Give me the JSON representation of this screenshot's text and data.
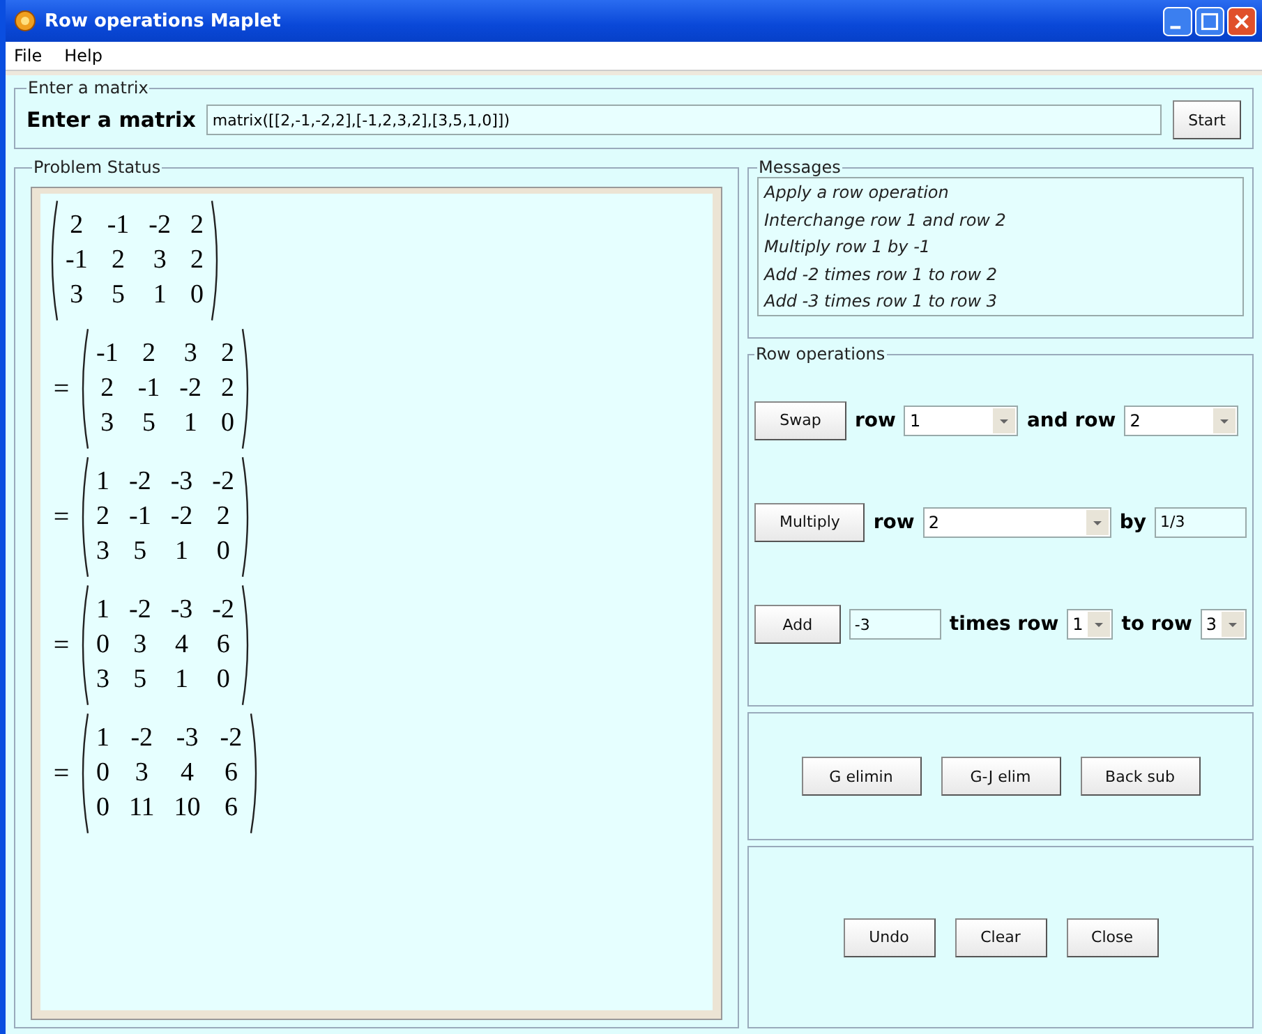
{
  "window": {
    "title": "Row operations Maplet"
  },
  "menu": [
    "File",
    "Help"
  ],
  "enter_matrix": {
    "group_title": "Enter a matrix",
    "label": "Enter a matrix",
    "value": "matrix([[2,-1,-2,2],[-1,2,3,2],[3,5,1,0]])",
    "button": "Start"
  },
  "problem_status": {
    "group_title": "Problem Status",
    "steps": [
      {
        "rows": [
          [
            "2",
            "-1",
            "-2",
            "2"
          ],
          [
            "-1",
            "2",
            "3",
            "2"
          ],
          [
            "3",
            "5",
            "1",
            "0"
          ]
        ]
      },
      {
        "relation": "=",
        "rows": [
          [
            "-1",
            "2",
            "3",
            "2"
          ],
          [
            "2",
            "-1",
            "-2",
            "2"
          ],
          [
            "3",
            "5",
            "1",
            "0"
          ]
        ]
      },
      {
        "relation": "=",
        "rows": [
          [
            "1",
            "-2",
            "-3",
            "-2"
          ],
          [
            "2",
            "-1",
            "-2",
            "2"
          ],
          [
            "3",
            "5",
            "1",
            "0"
          ]
        ]
      },
      {
        "relation": "=",
        "rows": [
          [
            "1",
            "-2",
            "-3",
            "-2"
          ],
          [
            "0",
            "3",
            "4",
            "6"
          ],
          [
            "3",
            "5",
            "1",
            "0"
          ]
        ]
      },
      {
        "relation": "=",
        "rows": [
          [
            "1",
            "-2",
            "-3",
            "-2"
          ],
          [
            "0",
            "3",
            "4",
            "6"
          ],
          [
            "0",
            "11",
            "10",
            "6"
          ]
        ]
      }
    ]
  },
  "messages": {
    "group_title": "Messages",
    "lines": [
      "Apply a row operation",
      "Interchange row 1 and row 2",
      "Multiply row 1 by -1",
      "Add -2 times row 1 to row 2",
      "Add -3 times row 1 to row 3"
    ]
  },
  "row_operations": {
    "group_title": "Row operations",
    "swap": {
      "button": "Swap",
      "label_1": "row",
      "row_1": "1",
      "label_2": "and row",
      "row_2": "2"
    },
    "multiply": {
      "button": "Multiply",
      "label_1": "row",
      "row": "2",
      "label_2": "by",
      "factor": "1/3"
    },
    "add": {
      "button": "Add",
      "factor": "-3",
      "label_1": "times row",
      "row_from": "1",
      "label_2": "to row",
      "row_to": "3"
    }
  },
  "elimination_buttons": [
    "G elimin",
    "G-J elim",
    "Back sub"
  ],
  "bottom_buttons": [
    "Undo",
    "Clear",
    "Close"
  ]
}
